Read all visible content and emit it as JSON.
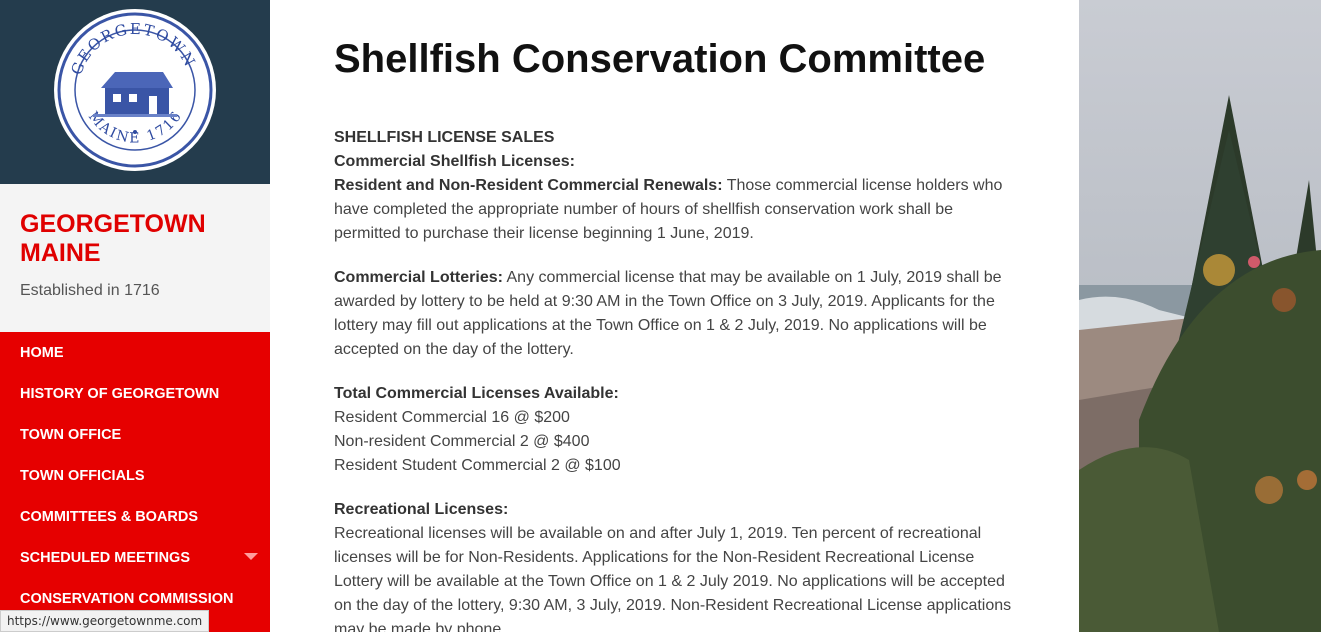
{
  "site": {
    "title": "GEORGETOWN MAINE",
    "description": "Established in 1716",
    "seal_top_text": "GEORGETOWN",
    "seal_bottom_left": "MAINE",
    "seal_bottom_right": "1716"
  },
  "nav": {
    "items": [
      {
        "label": "HOME"
      },
      {
        "label": "HISTORY OF GEORGETOWN"
      },
      {
        "label": "TOWN OFFICE"
      },
      {
        "label": "TOWN OFFICIALS"
      },
      {
        "label": "COMMITTEES & BOARDS"
      },
      {
        "label": "SCHEDULED MEETINGS"
      },
      {
        "label": "CONSERVATION COMMISSION"
      }
    ]
  },
  "status_bar": {
    "url": "https://www.georgetownme.com"
  },
  "page": {
    "title": "Shellfish Conservation Committee",
    "section_heading": "SHELLFISH LICENSE SALES",
    "commercial_heading": "Commercial Shellfish Licenses:",
    "renewals_label": "Resident and Non-Resident Commercial Renewals:",
    "renewals_text": " Those commercial license holders who have completed the appropriate number of hours of shellfish conservation work shall be permitted to purchase their license beginning 1 June, 2019.",
    "lotteries_label": "Commercial Lotteries:",
    "lotteries_text": " Any commercial license that may be available on 1 July, 2019 shall be awarded by lottery to be held at 9:30 AM in the Town Office on 3 July, 2019. Applicants for the lottery may fill out applications at the Town Office on 1 & 2 July, 2019. No applications will be accepted on the day of the lottery.",
    "total_label": "Total Commercial Licenses Available:",
    "total_lines": [
      "Resident Commercial 16 @ $200",
      "Non-resident Commercial 2 @ $400",
      "Resident Student Commercial 2 @ $100"
    ],
    "recreational_label": "Recreational Licenses:",
    "recreational_text": "Recreational licenses will be available on and after July 1, 2019. Ten percent of recreational licenses will be for Non-Residents. Applications for the Non-Resident Recreational License Lottery will be available at the Town Office on 1 & 2 July 2019. No applications will be accepted on the day of the lottery, 9:30 AM, 3 July, 2019. Non-Resident Recreational License applications may be made by phone."
  },
  "colors": {
    "sidebar_red": "#e60000",
    "logo_bg": "#243c4d",
    "title_red": "#e00000"
  }
}
